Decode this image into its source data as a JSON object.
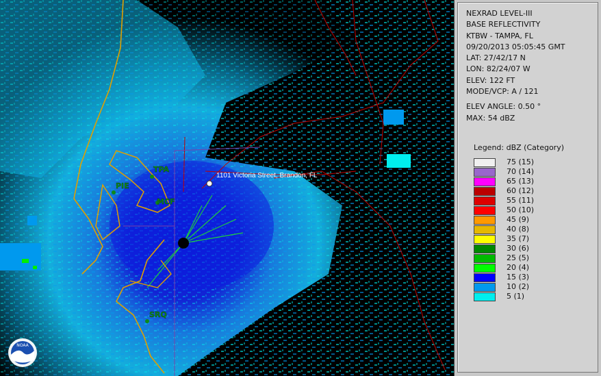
{
  "info": {
    "product": "NEXRAD LEVEL-III",
    "type": "BASE REFLECTIVITY",
    "station": "KTBW - TAMPA, FL",
    "datetime": "09/20/2013 05:05:45 GMT",
    "lat": "LAT: 27/42/17 N",
    "lon": "LON: 82/24/07 W",
    "elev": "ELEV: 122 FT",
    "mode": "MODE/VCP: A / 121",
    "elev_angle": "ELEV ANGLE: 0.50 °",
    "max": "MAX: 54 dBZ"
  },
  "legend": {
    "title": "Legend: dBZ (Category)",
    "entries": [
      {
        "label": "75  (15)",
        "color": "#f0f0f0"
      },
      {
        "label": "70  (14)",
        "color": "#9966cc"
      },
      {
        "label": "65  (13)",
        "color": "#ff00ff"
      },
      {
        "label": "60  (12)",
        "color": "#bb0000"
      },
      {
        "label": "55  (11)",
        "color": "#dd0000"
      },
      {
        "label": "50  (10)",
        "color": "#ff0000"
      },
      {
        "label": "45  (9)",
        "color": "#ff9900"
      },
      {
        "label": "40  (8)",
        "color": "#e6b800"
      },
      {
        "label": "35  (7)",
        "color": "#ffff00"
      },
      {
        "label": "30  (6)",
        "color": "#008800"
      },
      {
        "label": "25  (5)",
        "color": "#00bb00"
      },
      {
        "label": "20  (4)",
        "color": "#00ff00"
      },
      {
        "label": "15  (3)",
        "color": "#0000ff"
      },
      {
        "label": "10  (2)",
        "color": "#0099ee"
      },
      {
        "label": "5  (1)",
        "color": "#00eeee"
      }
    ]
  },
  "map": {
    "cities": [
      "TPA",
      "PIE",
      "MCF",
      "SRQ"
    ],
    "marker_label": "1101 Victoria Street, Brandon, FL",
    "logo_text": "NOAA"
  }
}
